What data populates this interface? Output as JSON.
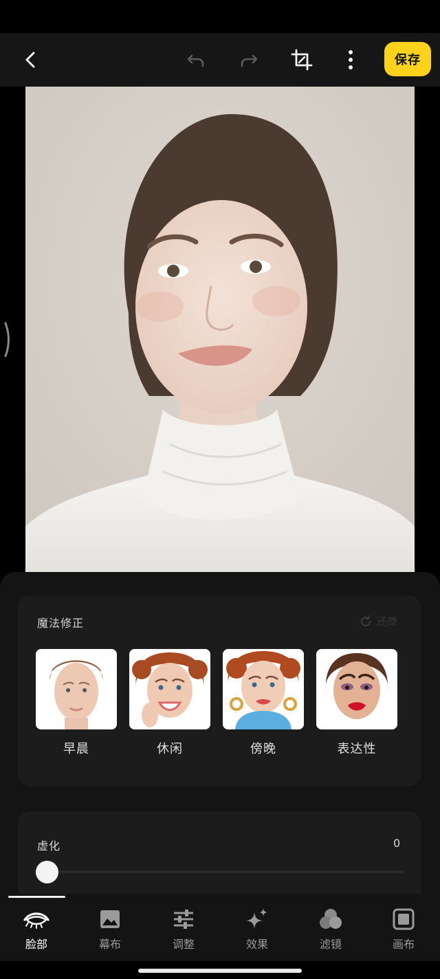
{
  "toolbar": {
    "back_icon": "chevron-left-icon",
    "undo_icon": "undo-icon",
    "redo_icon": "redo-icon",
    "crop_icon": "crop-icon",
    "more_icon": "more-vertical-icon",
    "save_label": "保存"
  },
  "colors": {
    "accent": "#fcd21c",
    "panel_bg": "#141414",
    "card_bg": "#1c1c1c",
    "toolbar_bg": "#161616"
  },
  "magic": {
    "title": "魔法修正",
    "reset_label": "还原",
    "presets": [
      {
        "label": "早晨"
      },
      {
        "label": "休闲"
      },
      {
        "label": "傍晚"
      },
      {
        "label": "表达性"
      }
    ]
  },
  "blur": {
    "label": "虚化",
    "value": "0",
    "slider_fraction": 0
  },
  "nav": {
    "items": [
      {
        "label": "脸部",
        "icon": "face-eye-icon",
        "active": true
      },
      {
        "label": "幕布",
        "icon": "image-icon",
        "active": false
      },
      {
        "label": "调整",
        "icon": "sliders-icon",
        "active": false
      },
      {
        "label": "效果",
        "icon": "sparkle-icon",
        "active": false
      },
      {
        "label": "滤镜",
        "icon": "filter-circles-icon",
        "active": false
      },
      {
        "label": "画布",
        "icon": "canvas-square-icon",
        "active": false
      }
    ]
  }
}
